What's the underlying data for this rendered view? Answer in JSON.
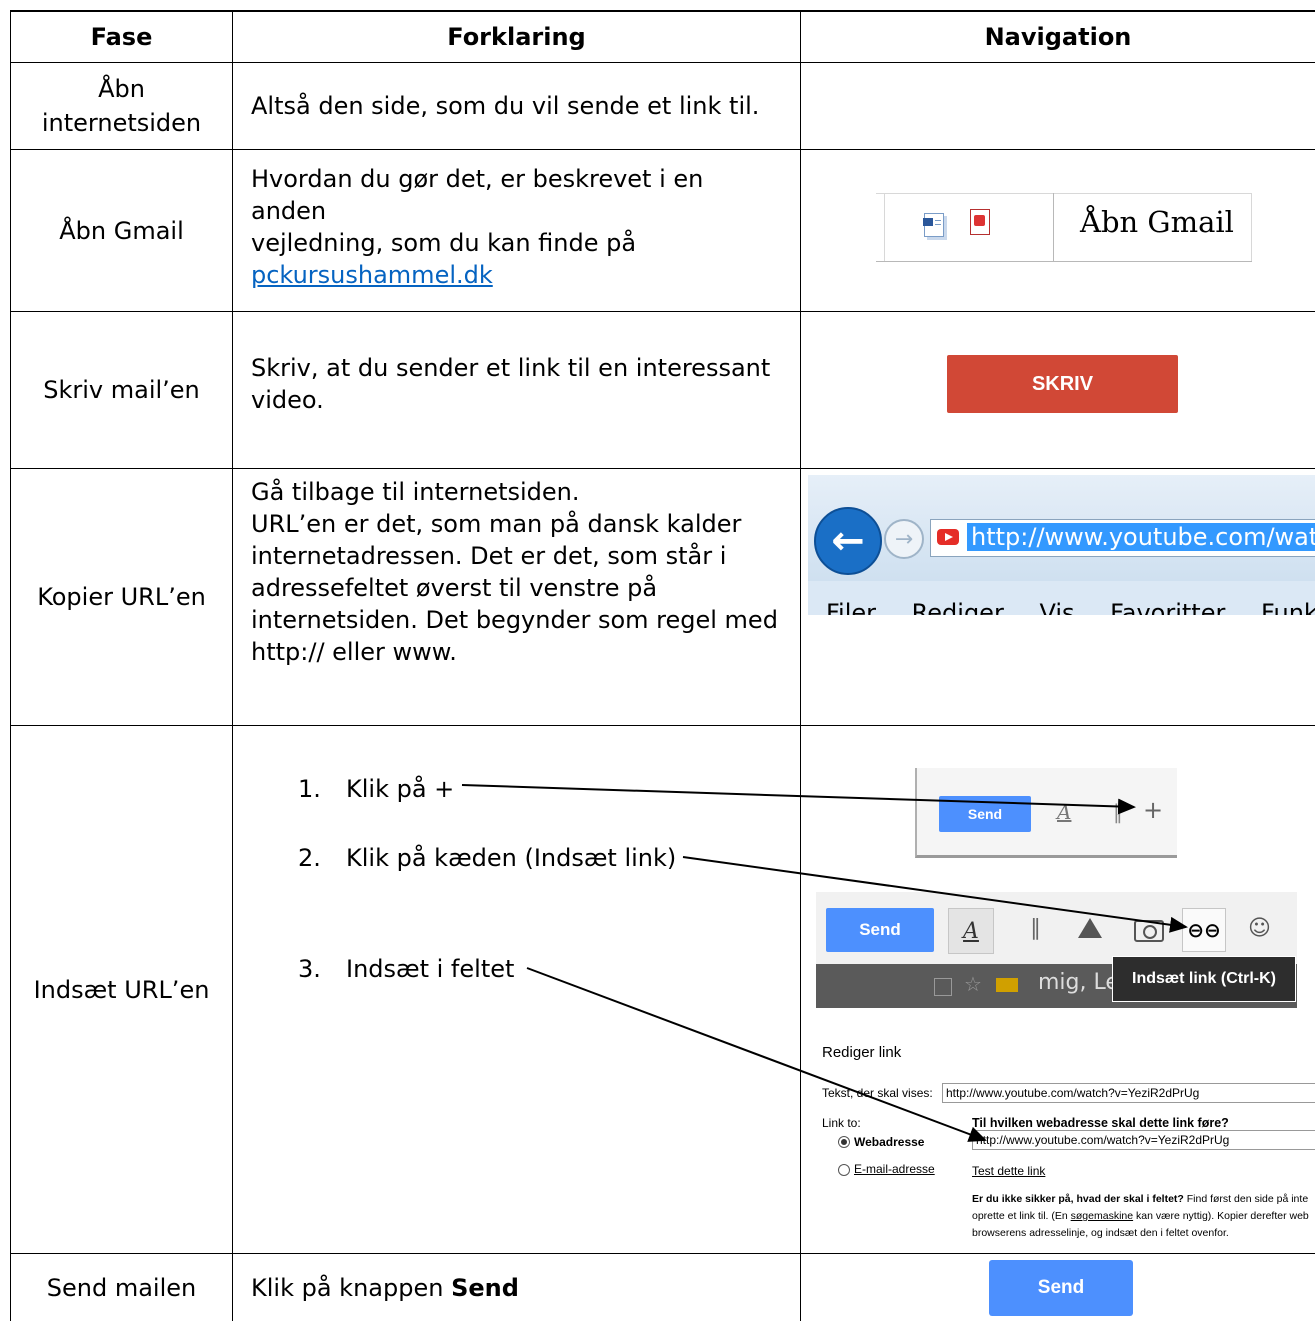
{
  "headers": {
    "fase": "Fase",
    "forklaring": "Forklaring",
    "navigation": "Navigation"
  },
  "rows": [
    {
      "fase": "Åbn internetsiden",
      "fase_line1": "Åbn",
      "fase_line2": "internetsiden",
      "forklaring": "Altså den side, som du vil sende et link til."
    },
    {
      "fase": "Åbn Gmail",
      "forklaring_lines": [
        "Hvordan du gør det, er beskrevet i en anden",
        "vejledning, som du kan finde på"
      ],
      "link": "pckursushammel.dk",
      "nav_label": "Åbn Gmail"
    },
    {
      "fase": "Skriv mail’en",
      "forklaring_lines": [
        "Skriv, at du sender et link til en interessant",
        "video."
      ],
      "nav_button": "SKRIV"
    },
    {
      "fase": "Kopier URL’en",
      "forklaring_lines": [
        "Gå tilbage til internetsiden.",
        "URL’en er det, som man på dansk kalder",
        "internetadressen. Det er det, som står i",
        "adressefeltet øverst til venstre på",
        "internetsiden. Det begynder som regel med",
        "http:// eller www."
      ],
      "nav_url": "http://www.youtube.com/watch",
      "nav_menu": [
        "Filer",
        "Rediger",
        "Vis",
        "Favoritter",
        "Funktioner"
      ]
    },
    {
      "fase": "Indsæt URL’en",
      "steps": [
        {
          "num": "1.",
          "text": "Klik på +"
        },
        {
          "num": "2.",
          "text": "Klik på kæden (Indsæt link)"
        },
        {
          "num": "3.",
          "text": "Indsæt i feltet"
        }
      ],
      "nav": {
        "send": "Send",
        "plus": "+",
        "tooltip": "Indsæt link (Ctrl-K)",
        "inbox_row": "mig, Le",
        "dialog_title": "Rediger link",
        "tekst_label": "Tekst, der skal vises:",
        "tekst_value": "http://www.youtube.com/watch?v=YeziR2dPrUg",
        "link_to": "Link to:",
        "question": "Til hvilken webadresse skal dette link føre?",
        "webadresse": "Webadresse",
        "url_value": "http://www.youtube.com/watch?v=YeziR2dPrUg",
        "email": "E-mail-adresse",
        "test": "Test dette link",
        "help_bold": "Er du ikke sikker på, hvad der skal i feltet?",
        "help_1": " Find først den side på inte",
        "help_2a": "oprette et link til. (En ",
        "help_2b": "søgemaskine",
        "help_2c": " kan være nyttig). Kopier derefter web",
        "help_3": "browserens adresselinje, og indsæt den i feltet ovenfor."
      }
    },
    {
      "fase": "Send mailen",
      "forklaring_plain": "Klik på knappen ",
      "forklaring_bold": "Send",
      "nav_button": "Send"
    }
  ],
  "colors": {
    "gmail_blue": "#4d90fe",
    "skriv_red": "#d14836",
    "youtube_red": "#e52d27",
    "link": "#0563c1"
  }
}
